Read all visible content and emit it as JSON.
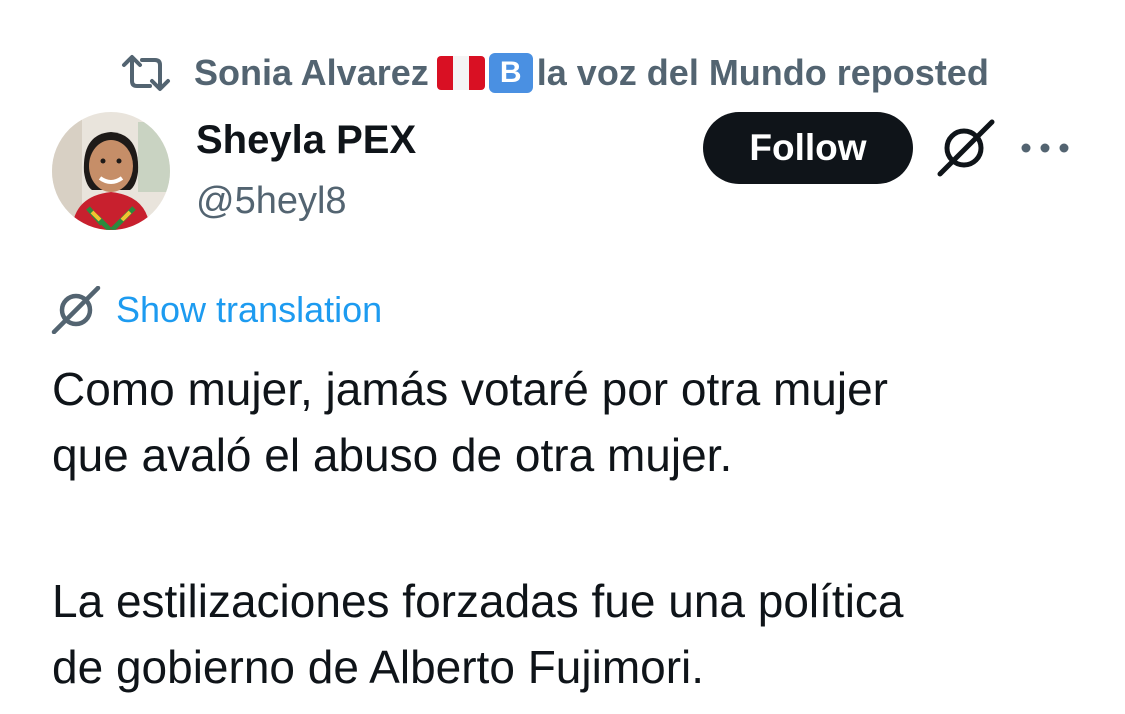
{
  "repost": {
    "icon": "repost-icon",
    "user_name": "Sonia Alvarez",
    "flag": "peru-flag",
    "badge_letter": "B",
    "suffix": "la voz del Mundo reposted"
  },
  "author": {
    "name": "Sheyla PEX",
    "handle": "@5heyl8"
  },
  "actions": {
    "follow_label": "Follow",
    "grok_icon": "grok-icon",
    "more_icon": "more-icon"
  },
  "translate": {
    "label": "Show translation"
  },
  "post": {
    "paragraph_1_line_1": "Como mujer, jamás votaré por otra mujer",
    "paragraph_1_line_2": "que avaló el abuso de otra mujer.",
    "paragraph_2_line_1": "La estilizaciones forzadas fue una política",
    "paragraph_2_line_2": "de gobierno de Alberto Fujimori."
  },
  "colors": {
    "text": "#0f1419",
    "secondary": "#536471",
    "link": "#1d9bf0",
    "button_bg": "#0f1419"
  }
}
